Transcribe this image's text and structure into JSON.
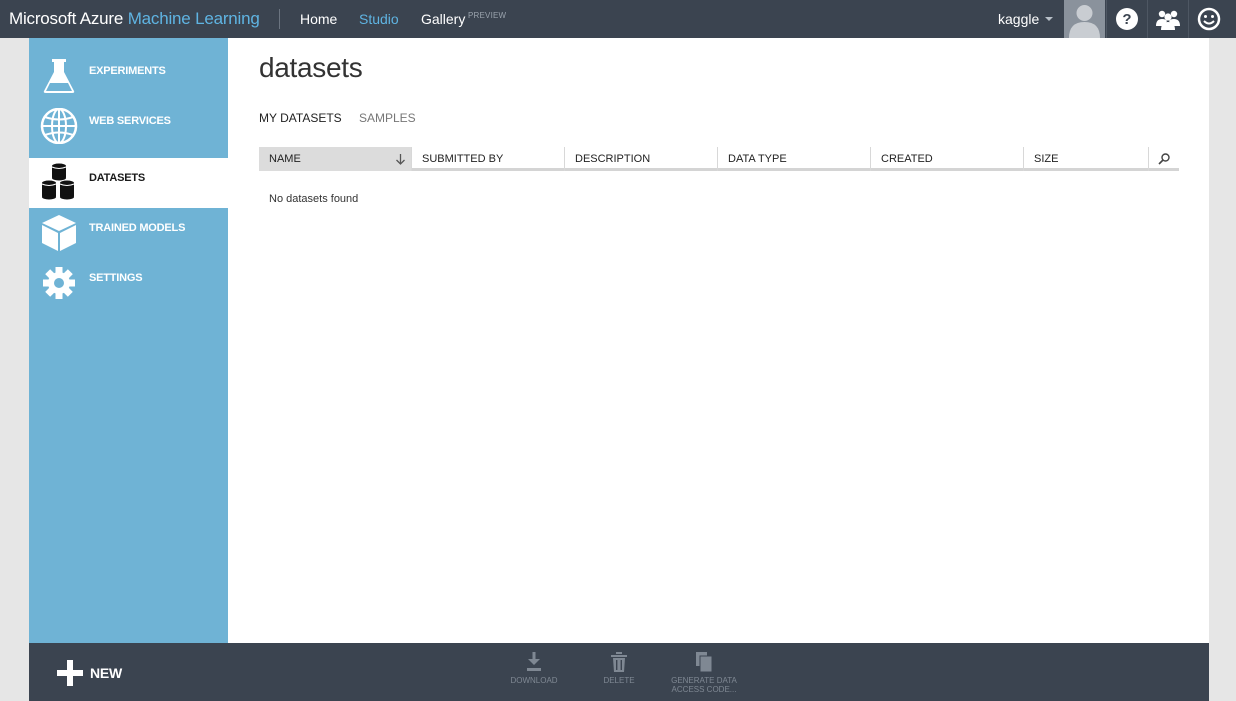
{
  "topbar": {
    "brand_part1": "Microsoft Azure",
    "brand_part2": "Machine Learning",
    "nav": {
      "home": "Home",
      "studio": "Studio",
      "gallery": "Gallery",
      "gallery_badge": "PREVIEW"
    },
    "user": "kaggle"
  },
  "sidebar": {
    "items": [
      {
        "label": "EXPERIMENTS",
        "icon": "flask-icon"
      },
      {
        "label": "WEB SERVICES",
        "icon": "globe-icon"
      },
      {
        "label": "DATASETS",
        "icon": "database-icon"
      },
      {
        "label": "TRAINED MODELS",
        "icon": "cube-icon"
      },
      {
        "label": "SETTINGS",
        "icon": "gear-icon"
      }
    ],
    "active": "DATASETS"
  },
  "main": {
    "title": "datasets",
    "tabs": [
      {
        "label": "MY DATASETS"
      },
      {
        "label": "SAMPLES"
      }
    ],
    "columns": [
      "NAME",
      "SUBMITTED BY",
      "DESCRIPTION",
      "DATA TYPE",
      "CREATED",
      "SIZE"
    ],
    "empty_message": "No datasets found"
  },
  "bottombar": {
    "new_label": "NEW",
    "commands": [
      {
        "label": "DOWNLOAD",
        "icon": "download-icon"
      },
      {
        "label": "DELETE",
        "icon": "trash-icon"
      },
      {
        "label_line1": "GENERATE DATA",
        "label_line2": "ACCESS CODE...",
        "icon": "copy-icon"
      }
    ]
  },
  "colors": {
    "topbar_bg": "#3b4450",
    "accent_blue": "#5fb4e2",
    "sidebar_bg": "#6fb3d5"
  }
}
